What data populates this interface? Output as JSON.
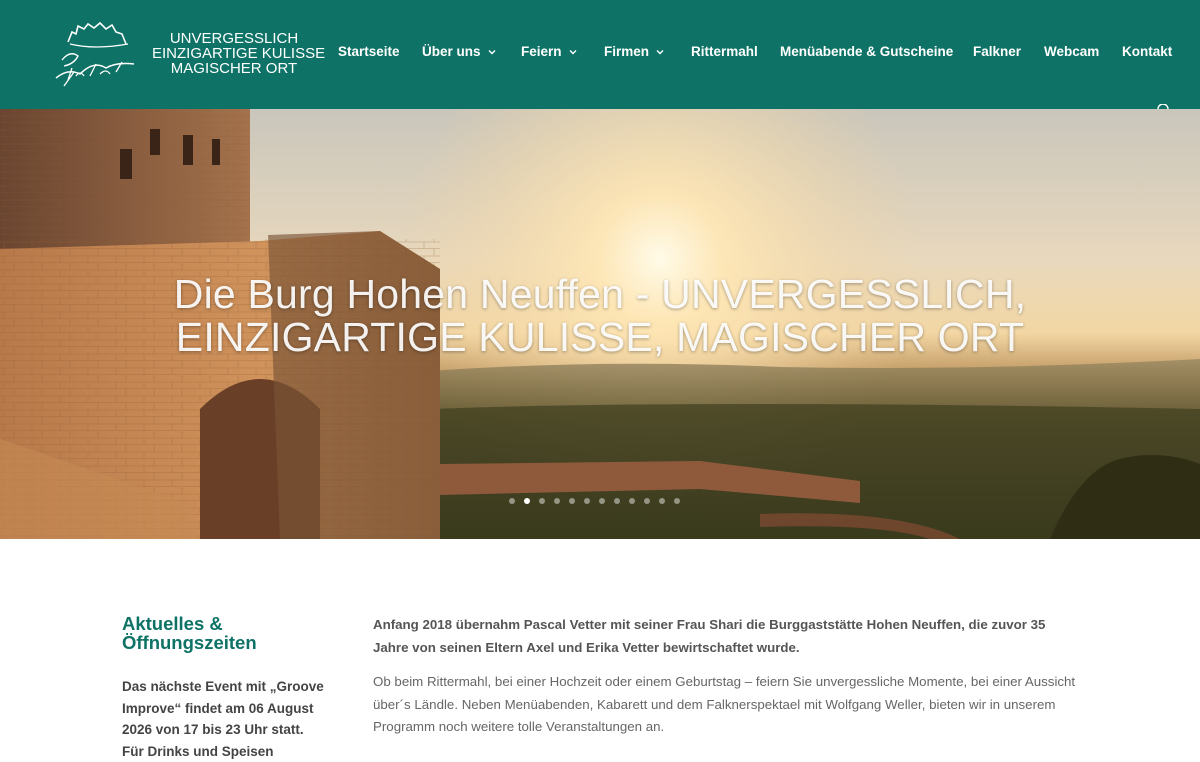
{
  "brand": {
    "logo_name": "Burg Hohen Neuffen",
    "tagline_lines": [
      "UNVERGESSLICH",
      "EINZIGARTIGE KULISSE",
      "MAGISCHER ORT"
    ]
  },
  "nav": {
    "items": [
      {
        "label": "Startseite",
        "has_dropdown": false,
        "active": true
      },
      {
        "label": "Über uns",
        "has_dropdown": true
      },
      {
        "label": "Feiern",
        "has_dropdown": true
      },
      {
        "label": "Firmen",
        "has_dropdown": true
      },
      {
        "label": "Rittermahl",
        "has_dropdown": false
      },
      {
        "label": "Menüabende & Gutscheine",
        "has_dropdown": false
      },
      {
        "label": "Falkner",
        "has_dropdown": false
      },
      {
        "label": "Webcam",
        "has_dropdown": false
      },
      {
        "label": "Kontakt",
        "has_dropdown": false
      }
    ],
    "search_icon": "search-icon"
  },
  "hero": {
    "title_line1": "Die Burg Hohen Neuffen - UNVERGESSLICH,",
    "title_line2": "EINZIGARTIGE KULISSE, MAGISCHER ORT",
    "slide_count": 12,
    "active_slide": 2
  },
  "sidebar": {
    "title_line1": "Aktuelles &",
    "title_line2": "Öffnungszeiten",
    "text": "Das nächste  Event mit „Groove Improve“ findet am 06 August 2026 von 17 bis 23 Uhr statt. Für Drinks und Speisen"
  },
  "main": {
    "lead": "Anfang 2018 übernahm Pascal Vetter mit seiner Frau Shari die Burggaststätte Hohen Neuffen, die zuvor 35 Jahre von seinen Eltern Axel und Erika Vetter bewirtschaftet wurde.",
    "body": "Ob beim Rittermahl, bei einer Hochzeit oder einem Geburtstag – feiern Sie unvergessliche Momente, bei einer Aussicht über´s Ländle. Neben Menüabenden, Kabarett und dem Falknerspektael mit Wolfgang Weller, bieten wir in unserem Programm noch weitere tolle Veranstaltungen an."
  },
  "colors": {
    "header_bg": "#0e7366",
    "accent": "#0e7366"
  }
}
